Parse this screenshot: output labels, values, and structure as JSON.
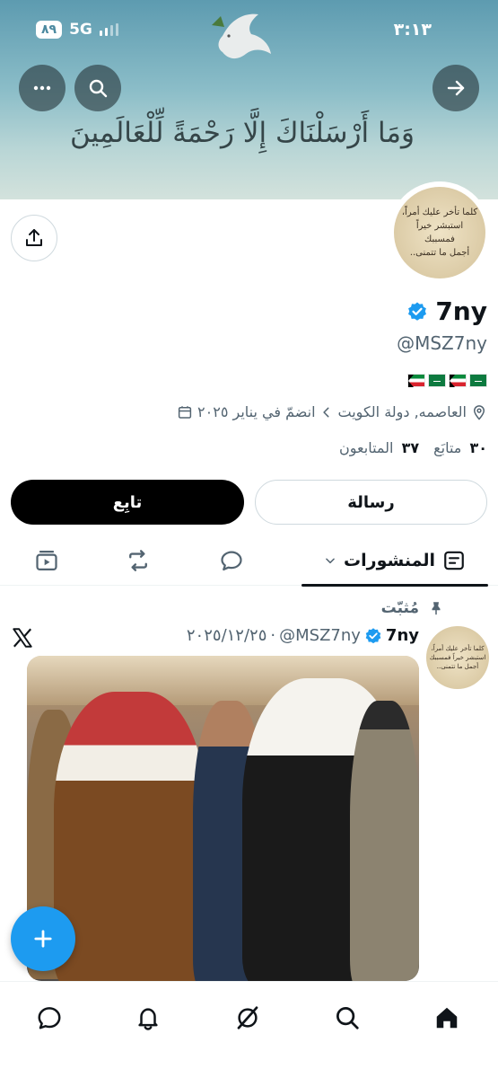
{
  "status_bar": {
    "time": "٣:١٣",
    "network": "5G",
    "battery": "٨٩"
  },
  "banner": {
    "verse": "وَمَا أَرْسَلْنَاكَ إِلَّا رَحْمَةً لِّلْعَالَمِينَ"
  },
  "avatar_text": [
    "كلما تأخر عليك أمراً،",
    "استبشر خيراً فمسببك",
    "أجمل ما تتمنى.."
  ],
  "profile": {
    "display_name": "7ny",
    "handle": "@MSZ7ny",
    "location": "العاصمه, دولة الكويت",
    "joined": "انضمّ في يناير ٢٠٢٥",
    "following_count": "٣٠",
    "following_label": "متابَع",
    "followers_count": "٣٧",
    "followers_label": "المتابعون",
    "message_label": "رسالة",
    "follow_label": "تابِع"
  },
  "tabs": {
    "posts_label": "المنشورات"
  },
  "post": {
    "pinned_label": "مُثبّت",
    "name": "7ny",
    "handle": "@MSZ7ny",
    "separator": "·",
    "date": "٢٠٢٥/١٢/٢٥"
  },
  "colors": {
    "accent": "#1d9bf0",
    "text": "#0f1419",
    "secondary": "#536471",
    "border": "#cfd9de"
  },
  "icons": [
    "more-icon",
    "search-icon",
    "arrow-forward-icon",
    "share-icon",
    "verified-badge-icon",
    "location-icon",
    "calendar-icon",
    "chevron-icon",
    "posts-icon",
    "dropdown-icon",
    "reply-icon",
    "repost-icon",
    "media-icon",
    "pin-icon",
    "x-logo-icon",
    "plus-icon",
    "messages-icon",
    "notifications-icon",
    "grok-icon",
    "search-nav-icon",
    "home-icon"
  ]
}
